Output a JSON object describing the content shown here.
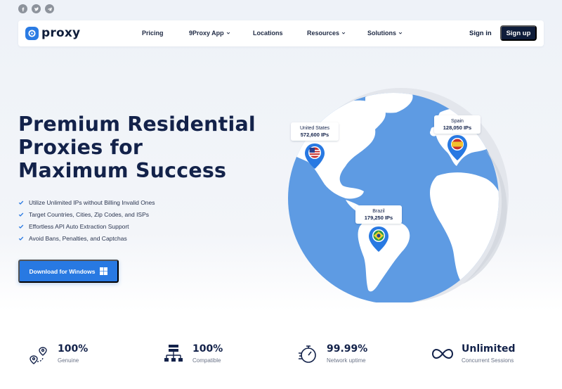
{
  "social": [
    "facebook-icon",
    "twitter-icon",
    "telegram-icon"
  ],
  "brand": {
    "name": "proxy",
    "color": "#2b7be3"
  },
  "nav": {
    "items": [
      {
        "label": "Pricing",
        "dropdown": false
      },
      {
        "label": "9Proxy App",
        "dropdown": true
      },
      {
        "label": "Locations",
        "dropdown": false
      },
      {
        "label": "Resources",
        "dropdown": true
      },
      {
        "label": "Solutions",
        "dropdown": true
      }
    ],
    "sign_in": "Sign in",
    "sign_up": "Sign up"
  },
  "hero": {
    "headline_lines": [
      "Premium Residential",
      "Proxies for",
      "Maximum Success"
    ],
    "features": [
      "Utilize Unlimited IPs without Billing Invalid Ones",
      "Target Countries, Cities, Zip Codes, and ISPs",
      "Effortless API Auto Extraction Support",
      "Avoid Bans, Penalties, and Captchas"
    ],
    "download_label": "Download for Windows"
  },
  "globe": {
    "locations": [
      {
        "country": "United States",
        "ips": "572,600 IPs",
        "flag": "us-flag"
      },
      {
        "country": "Spain",
        "ips": "128,050 IPs",
        "flag": "spain-flag"
      },
      {
        "country": "Brazil",
        "ips": "179,250 IPs",
        "flag": "brazil-flag"
      }
    ]
  },
  "stats": [
    {
      "value": "100%",
      "label": "Genuine",
      "icon": "location-pins-icon"
    },
    {
      "value": "100%",
      "label": "Compatible",
      "icon": "server-network-icon"
    },
    {
      "value": "99.99%",
      "label": "Network uptime",
      "icon": "stopwatch-icon"
    },
    {
      "value": "Unlimited",
      "label": "Concurrent Sessions",
      "icon": "infinity-icon"
    }
  ],
  "colors": {
    "navy": "#0f1d3a",
    "accent": "#2879e2",
    "ocean": "#5e9be3",
    "land": "#ffffff"
  }
}
